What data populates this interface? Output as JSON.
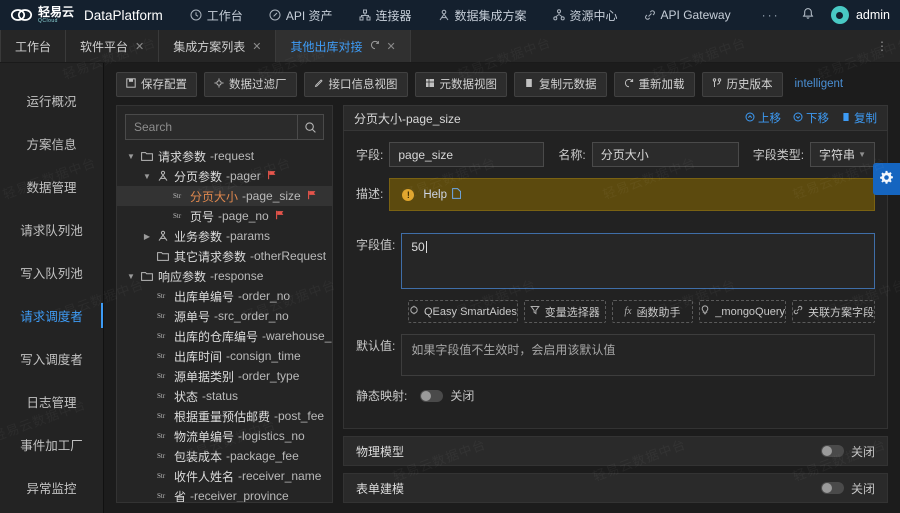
{
  "topbar": {
    "brand_cn": "轻易云",
    "brand_sub": "QCloud",
    "product": "DataPlatform",
    "nav": [
      {
        "label": "工作台",
        "icon": "clock-icon"
      },
      {
        "label": "API 资产",
        "icon": "compass-icon"
      },
      {
        "label": "连接器",
        "icon": "hierarchy-icon"
      },
      {
        "label": "数据集成方案",
        "icon": "people-icon"
      },
      {
        "label": "资源中心",
        "icon": "sitemap-icon"
      },
      {
        "label": "API Gateway",
        "icon": "link-icon"
      }
    ],
    "overflow": "···",
    "bell": "bell-icon",
    "user": "admin"
  },
  "tabs": [
    {
      "label": "工作台",
      "closable": false,
      "active": false,
      "reloadable": false
    },
    {
      "label": "软件平台",
      "closable": true,
      "active": false,
      "reloadable": false
    },
    {
      "label": "集成方案列表",
      "closable": true,
      "active": false,
      "reloadable": false
    },
    {
      "label": "其他出库对接",
      "closable": true,
      "active": true,
      "reloadable": true
    }
  ],
  "tab_menu": "⋮",
  "sidebar": {
    "items": [
      {
        "label": "运行概况",
        "active": false
      },
      {
        "label": "方案信息",
        "active": false
      },
      {
        "label": "数据管理",
        "active": false
      },
      {
        "label": "请求队列池",
        "active": false
      },
      {
        "label": "写入队列池",
        "active": false
      },
      {
        "label": "请求调度者",
        "active": true
      },
      {
        "label": "写入调度者",
        "active": false
      },
      {
        "label": "日志管理",
        "active": false
      },
      {
        "label": "事件加工厂",
        "active": false
      },
      {
        "label": "异常监控",
        "active": false
      }
    ]
  },
  "toolbar": {
    "buttons": [
      {
        "label": "保存配置",
        "icon": "save-icon"
      },
      {
        "label": "数据过滤厂",
        "icon": "filter-gear-icon"
      },
      {
        "label": "接口信息视图",
        "icon": "pen-icon"
      },
      {
        "label": "元数据视图",
        "icon": "table-icon"
      },
      {
        "label": "复制元数据",
        "icon": "copy-icon"
      },
      {
        "label": "重新加载",
        "icon": "refresh-icon"
      },
      {
        "label": "历史版本",
        "icon": "branch-icon"
      }
    ],
    "link": "intelligent"
  },
  "tree": {
    "search_placeholder": "Search",
    "search_value": "",
    "search_icon": "search-icon",
    "nodes": [
      {
        "cn": "请求参数",
        "en": "-request",
        "type": "folder",
        "depth": 0,
        "caret": "down",
        "flag": false,
        "selected": false
      },
      {
        "cn": "分页参数",
        "en": "-pager",
        "type": "group",
        "depth": 1,
        "caret": "down",
        "flag": true,
        "selected": false
      },
      {
        "cn": "分页大小",
        "en": "-page_size",
        "type": "str",
        "depth": 2,
        "caret": "none",
        "flag": true,
        "selected": true
      },
      {
        "cn": "页号",
        "en": "-page_no",
        "type": "str",
        "depth": 2,
        "caret": "none",
        "flag": true,
        "selected": false
      },
      {
        "cn": "业务参数",
        "en": "-params",
        "type": "group",
        "depth": 1,
        "caret": "right",
        "flag": false,
        "selected": false
      },
      {
        "cn": "其它请求参数",
        "en": "-otherRequest",
        "type": "folder",
        "depth": 1,
        "caret": "none",
        "flag": false,
        "selected": false
      },
      {
        "cn": "响应参数",
        "en": "-response",
        "type": "folder",
        "depth": 0,
        "caret": "down",
        "flag": false,
        "selected": false
      },
      {
        "cn": "出库单编号",
        "en": "-order_no",
        "type": "str",
        "depth": 1,
        "caret": "none",
        "flag": false,
        "selected": false
      },
      {
        "cn": "源单号",
        "en": "-src_order_no",
        "type": "str",
        "depth": 1,
        "caret": "none",
        "flag": false,
        "selected": false
      },
      {
        "cn": "出库的仓库编号",
        "en": "-warehouse_no",
        "type": "str",
        "depth": 1,
        "caret": "none",
        "flag": false,
        "selected": false
      },
      {
        "cn": "出库时间",
        "en": "-consign_time",
        "type": "str",
        "depth": 1,
        "caret": "none",
        "flag": false,
        "selected": false
      },
      {
        "cn": "源单据类别",
        "en": "-order_type",
        "type": "str",
        "depth": 1,
        "caret": "none",
        "flag": false,
        "selected": false
      },
      {
        "cn": "状态",
        "en": "-status",
        "type": "str",
        "depth": 1,
        "caret": "none",
        "flag": false,
        "selected": false
      },
      {
        "cn": "根据重量预估邮费",
        "en": "-post_fee",
        "type": "str",
        "depth": 1,
        "caret": "none",
        "flag": false,
        "selected": false
      },
      {
        "cn": "物流单编号",
        "en": "-logistics_no",
        "type": "str",
        "depth": 1,
        "caret": "none",
        "flag": false,
        "selected": false
      },
      {
        "cn": "包装成本",
        "en": "-package_fee",
        "type": "str",
        "depth": 1,
        "caret": "none",
        "flag": false,
        "selected": false
      },
      {
        "cn": "收件人姓名",
        "en": "-receiver_name",
        "type": "str",
        "depth": 1,
        "caret": "none",
        "flag": false,
        "selected": false
      },
      {
        "cn": "省",
        "en": "-receiver_province",
        "type": "str",
        "depth": 1,
        "caret": "none",
        "flag": false,
        "selected": false
      }
    ]
  },
  "detail": {
    "title": "分页大小-page_size",
    "actions": [
      {
        "label": "上移",
        "icon": "arrow-up-circle-icon"
      },
      {
        "label": "下移",
        "icon": "arrow-down-circle-icon"
      },
      {
        "label": "复制",
        "icon": "copy-icon"
      }
    ],
    "field_label": "字段:",
    "field_value": "page_size",
    "name_label": "名称:",
    "name_value": "分页大小",
    "type_label": "字段类型:",
    "type_value": "字符串",
    "desc_label": "描述:",
    "help_text": "Help",
    "help_icon": "doc-icon",
    "warn_icon": "warning-icon",
    "value_label": "字段值:",
    "value_text": "50",
    "helpers": [
      {
        "label": "QEasy SmartAides",
        "icon": "sparkle-icon"
      },
      {
        "label": "变量选择器",
        "icon": "funnel-icon"
      },
      {
        "label": "函数助手",
        "icon": "fx-icon"
      },
      {
        "label": "_mongoQuery",
        "icon": "bulb-icon"
      },
      {
        "label": "关联方案字段",
        "icon": "link-icon"
      }
    ],
    "default_label": "默认值:",
    "default_placeholder": "如果字段值不生效时，会启用该默认值",
    "static_map_label": "静态映射:",
    "static_map_state": "关闭",
    "sections": [
      {
        "label": "物理模型",
        "state": "关闭"
      },
      {
        "label": "表单建模",
        "state": "关闭"
      }
    ]
  },
  "fab": {
    "icon": "gear-icon"
  },
  "watermark": "轻易云数据中台",
  "colors": {
    "topbar_bg": "#14202e",
    "accent_blue": "#3d9bf5",
    "accent_teal": "#49c9c4",
    "flag_red": "#e5544b",
    "help_bg": "#5c4a0e",
    "fab_blue": "#1565c0"
  }
}
